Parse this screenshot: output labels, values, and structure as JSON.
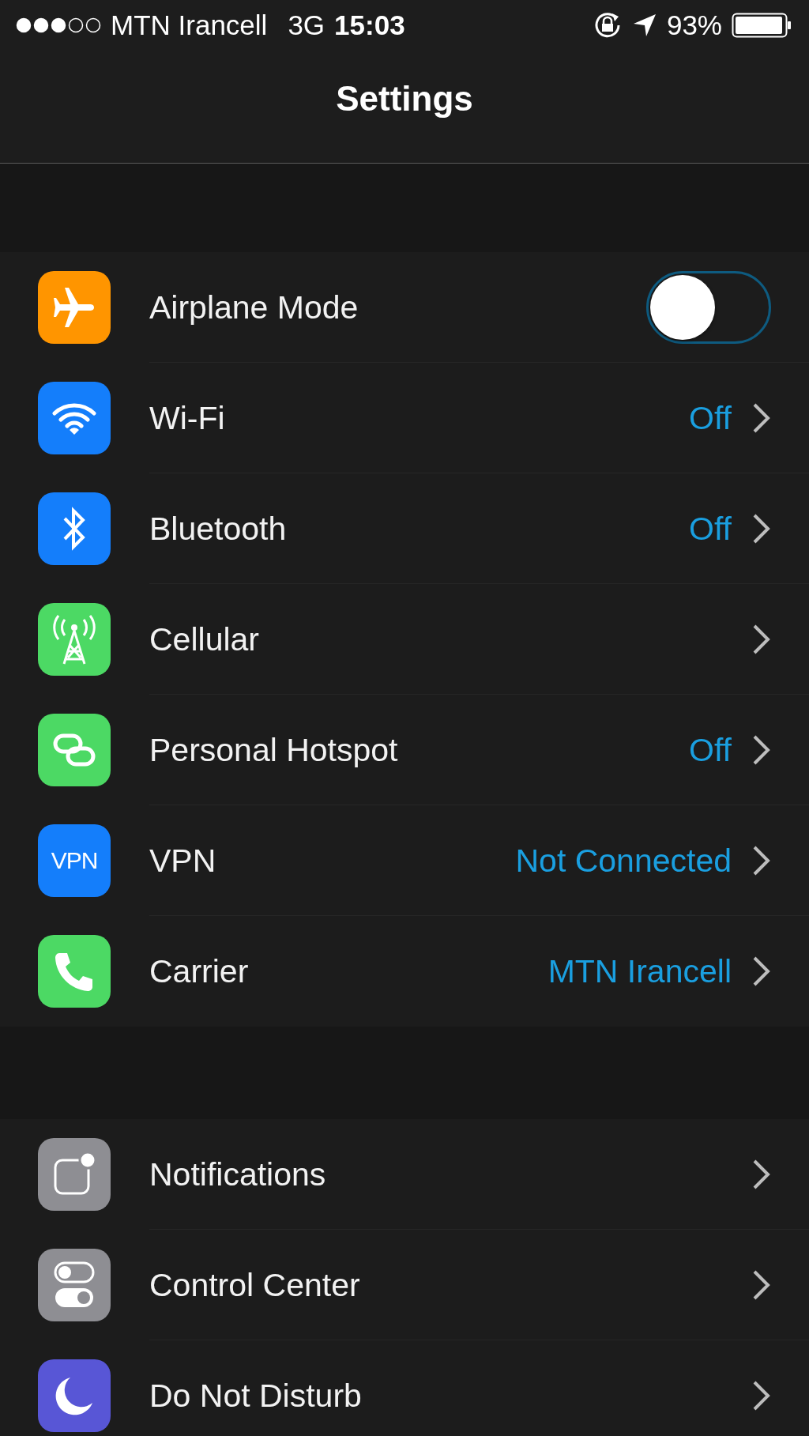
{
  "status_bar": {
    "carrier": "MTN Irancell",
    "network": "3G",
    "time": "15:03",
    "battery": "93%"
  },
  "title": "Settings",
  "groups": [
    {
      "rows": [
        {
          "kind": "toggle",
          "label": "Airplane Mode",
          "color": "#ff9500",
          "on": false
        },
        {
          "kind": "link",
          "label": "Wi-Fi",
          "value": "Off",
          "color": "#147efb"
        },
        {
          "kind": "link",
          "label": "Bluetooth",
          "value": "Off",
          "color": "#147efb"
        },
        {
          "kind": "link",
          "label": "Cellular",
          "color": "#4cd964"
        },
        {
          "kind": "link",
          "label": "Personal Hotspot",
          "value": "Off",
          "color": "#4cd964"
        },
        {
          "kind": "link",
          "label": "VPN",
          "value": "Not Connected",
          "color": "#147efb",
          "badge": "VPN"
        },
        {
          "kind": "link",
          "label": "Carrier",
          "value": "MTN Irancell",
          "color": "#4cd964"
        }
      ]
    },
    {
      "rows": [
        {
          "kind": "link",
          "label": "Notifications",
          "color": "#8e8e93"
        },
        {
          "kind": "link",
          "label": "Control Center",
          "color": "#8e8e93"
        },
        {
          "kind": "link",
          "label": "Do Not Disturb",
          "color": "#5856d6"
        }
      ]
    }
  ]
}
